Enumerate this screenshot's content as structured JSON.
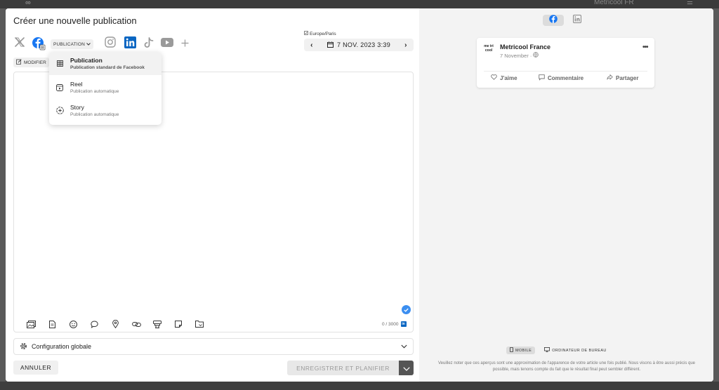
{
  "background": {
    "brand_label": "Metricool FR",
    "logo": "infinity-logo",
    "menu_icon": "hamburger-icon"
  },
  "header": {
    "title": "Créer une nouvelle publication"
  },
  "networks": {
    "items": [
      {
        "name": "x-twitter",
        "icon": "x-twitter-icon",
        "selected": false
      },
      {
        "name": "facebook",
        "icon": "facebook-icon",
        "selected": true
      },
      {
        "name": "instagram",
        "icon": "instagram-icon",
        "selected": false
      },
      {
        "name": "linkedin",
        "icon": "linkedin-icon",
        "selected": true
      },
      {
        "name": "tiktok",
        "icon": "tiktok-icon",
        "selected": false
      },
      {
        "name": "youtube",
        "icon": "youtube-icon",
        "selected": false
      }
    ],
    "add_icon": "plus-icon",
    "publication_type_label": "PUBLICATION"
  },
  "schedule": {
    "timezone": "Europe/Paris",
    "date_text": "7 NOV. 2023 3:39"
  },
  "editor": {
    "modify_label": "MODIFIER",
    "text_value": "",
    "counter": "0 / 3000",
    "toolbar_icons": [
      "media-icon",
      "document-icon",
      "emoji-icon",
      "comment-icon",
      "location-icon",
      "link-icon",
      "hashtag-icon",
      "note-icon",
      "folder-icon"
    ]
  },
  "pub_type_menu": {
    "items": [
      {
        "label": "Publication",
        "sub": "Publication standard de Facebook",
        "icon": "grid-icon",
        "active": true
      },
      {
        "label": "Reel",
        "sub": "Publication automatique",
        "icon": "reel-icon",
        "active": false
      },
      {
        "label": "Story",
        "sub": "Publication automatique",
        "icon": "story-icon",
        "active": false
      }
    ]
  },
  "footer": {
    "config_label": "Configuration globale",
    "cancel_label": "ANNULER",
    "save_label": "ENREGISTRER ET PLANIFIER"
  },
  "preview": {
    "account_name": "Metricool France",
    "avatar_text": "me tri cool",
    "post_date": "7 November ·",
    "actions": [
      "J'aime",
      "Commentaire",
      "Partager"
    ],
    "view_mobile": "MOBILE",
    "view_desktop": "ORDINATEUR DE BUREAU",
    "disclaimer": "Veuillez noter que ces aperçus sont une approximation de l'apparence de votre article une fois publié. Nous visons à être aussi précis que possible, mais tenons compte du fait que le résultat final peut sembler différent."
  },
  "colors": {
    "facebook": "#1877f2",
    "linkedin": "#0a66c2",
    "check": "#3b8ef0",
    "save_disabled_bg": "#e8e8e8",
    "save_drop_bg": "#555555"
  }
}
